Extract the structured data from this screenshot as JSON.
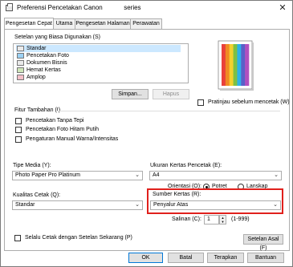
{
  "window": {
    "title": "Preferensi Pencetakan Canon",
    "title_suffix": "series",
    "close_glyph": "✕"
  },
  "tabs": [
    {
      "label": "Pengesetan Cepat"
    },
    {
      "label": "Utama"
    },
    {
      "label": "Pengesetan Halaman"
    },
    {
      "label": "Perawatan"
    }
  ],
  "common_settings": {
    "label": "Setelan yang Biasa Digunakan (S)",
    "items": [
      "Standar",
      "Pencetakan Foto",
      "Dokumen Bisnis",
      "Hemat Kertas",
      "Amplop"
    ],
    "selected_index": 0,
    "save_button": "Simpan...",
    "delete_button": "Hapus"
  },
  "preview": {
    "label": "Pratinjau sebelum mencetak (W)",
    "checked": false,
    "colors": [
      "#e9403c",
      "#f08a24",
      "#f3d12e",
      "#7cc143",
      "#2db2e8",
      "#5a5fc8",
      "#b04fbf"
    ]
  },
  "additional": {
    "label": "Fitur Tambahan (I)",
    "options": [
      {
        "label": "Pencetakan Tanpa Tepi",
        "checked": false
      },
      {
        "label": "Pencetakan Foto Hitam Putih",
        "checked": false
      },
      {
        "label": "Pengaturan Manual Warna/Intensitas",
        "checked": false
      }
    ]
  },
  "media_type": {
    "label": "Tipe Media (Y):",
    "value": "Photo Paper Pro Platinum"
  },
  "paper_size": {
    "label": "Ukuran Kertas Pencetak (E):",
    "value": "A4"
  },
  "orientation": {
    "label": "Orientasi (O):",
    "portrait": "Potret",
    "landscape": "Lanskap",
    "selected": "portrait"
  },
  "print_quality": {
    "label": "Kualitas Cetak (Q):",
    "value": "Standar"
  },
  "paper_source": {
    "label": "Sumber Kertas (R):",
    "value": "Penyalur Atas",
    "highlight_color": "#e0201c"
  },
  "copies": {
    "label": "Salinan (C):",
    "value": "1",
    "range": "(1-999)"
  },
  "always_print": {
    "label": "Selalu Cetak dengan Setelan Sekarang (P)",
    "checked": false
  },
  "defaults_button": "Setelan Asal (F)",
  "footer": {
    "ok": "OK",
    "cancel": "Batal",
    "apply": "Terapkan",
    "help": "Bantuan"
  }
}
